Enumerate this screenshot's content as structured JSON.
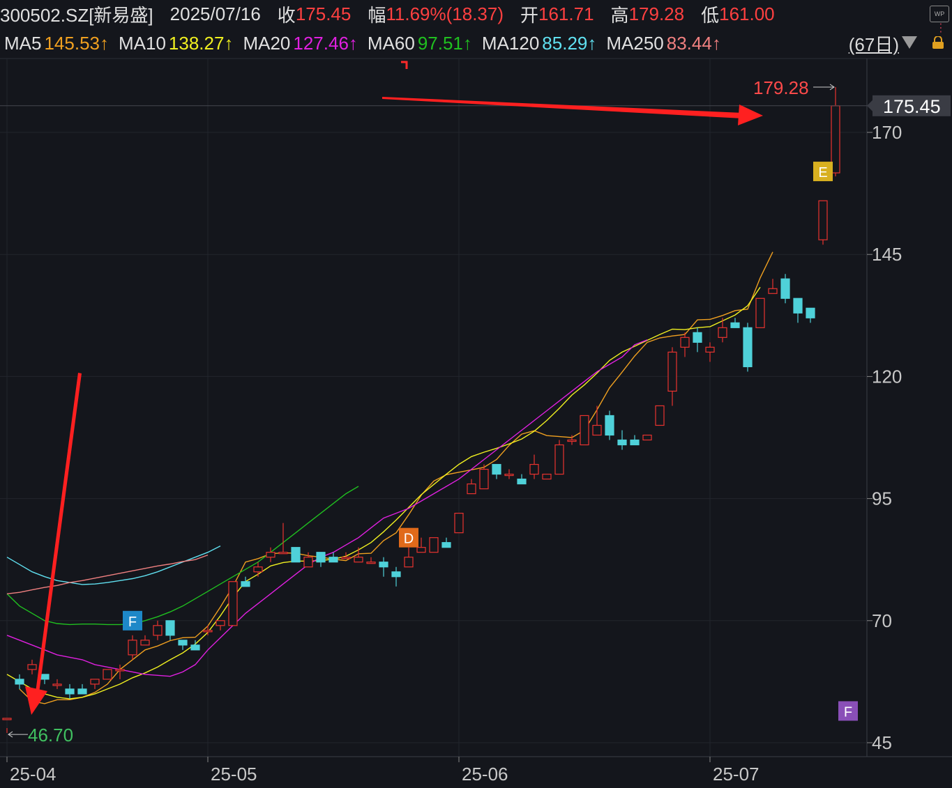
{
  "header": {
    "symbol": "300502.SZ[新易盛]",
    "date": "2025/07/16",
    "close_label": "收",
    "close": "175.45",
    "change_label": "幅",
    "change": "11.69%(18.37)",
    "open_label": "开",
    "open": "161.71",
    "high_label": "高",
    "high": "179.28",
    "low_label": "低",
    "low": "161.00"
  },
  "ma": [
    {
      "name": "MA5",
      "value": "145.53↑",
      "color": "#f0a020"
    },
    {
      "name": "MA10",
      "value": "138.27↑",
      "color": "#f0f020"
    },
    {
      "name": "MA20",
      "value": "127.46↑",
      "color": "#e020e0"
    },
    {
      "name": "MA60",
      "value": "97.51↑",
      "color": "#20c020"
    },
    {
      "name": "MA120",
      "value": "85.29↑",
      "color": "#60e0f0"
    },
    {
      "name": "MA250",
      "value": "83.44↑",
      "color": "#f08080"
    }
  ],
  "period_label": "(67日)",
  "chart_data": {
    "type": "candlestick",
    "y_ticks": [
      45,
      70,
      95,
      120,
      145,
      170
    ],
    "ylim": [
      44,
      180
    ],
    "x_ticks": [
      {
        "label": "25-04",
        "index": 0
      },
      {
        "label": "25-05",
        "index": 16
      },
      {
        "label": "25-06",
        "index": 36
      },
      {
        "label": "25-07",
        "index": 56
      }
    ],
    "last_price": 175.45,
    "max_label": {
      "value": 179.28,
      "text": "179.28"
    },
    "min_label": {
      "value": 46.7,
      "text": "46.70"
    },
    "markers": [
      {
        "text": "F",
        "index": 10,
        "value": 70,
        "color": "#1e88c8"
      },
      {
        "text": "D",
        "index": 32,
        "value": 87,
        "color": "#e06a1a"
      },
      {
        "text": "E",
        "index": 65,
        "value": 162,
        "color": "#d8b020"
      },
      {
        "text": "F",
        "index": 67,
        "value": 51.5,
        "color": "#8a4fb8"
      }
    ],
    "candles": [
      [
        50,
        50,
        48,
        47
      ],
      [
        58,
        57,
        59,
        56
      ],
      [
        60,
        61,
        62,
        59
      ],
      [
        59,
        58,
        59,
        57
      ],
      [
        57,
        57,
        58,
        56
      ],
      [
        56,
        55,
        57,
        54
      ],
      [
        56,
        55,
        57,
        55
      ],
      [
        57,
        58,
        58,
        56
      ],
      [
        58,
        60,
        60,
        58
      ],
      [
        60,
        60,
        61,
        58
      ],
      [
        63,
        66,
        67,
        62
      ],
      [
        65,
        66,
        67,
        65
      ],
      [
        67,
        69,
        70,
        66
      ],
      [
        70,
        67,
        70,
        66
      ],
      [
        66,
        65,
        66,
        64
      ],
      [
        65,
        64,
        66,
        64
      ],
      [
        68,
        68,
        69,
        67
      ],
      [
        69,
        70,
        70,
        68
      ],
      [
        69,
        78,
        78,
        69
      ],
      [
        78,
        77,
        79,
        77
      ],
      [
        80,
        81,
        82,
        79
      ],
      [
        83,
        84,
        85,
        82
      ],
      [
        84,
        84,
        90,
        84
      ],
      [
        85,
        82,
        85,
        82
      ],
      [
        81,
        83,
        84,
        81
      ],
      [
        84,
        82,
        84,
        81
      ],
      [
        83,
        82,
        84,
        83
      ],
      [
        83,
        83,
        84,
        83
      ],
      [
        82,
        83,
        85,
        82
      ],
      [
        82,
        82,
        83,
        82
      ],
      [
        82,
        81,
        83,
        79
      ],
      [
        80,
        79,
        81,
        77
      ],
      [
        81,
        83,
        85,
        81
      ],
      [
        84,
        85,
        87,
        84
      ],
      [
        84,
        87,
        87,
        84
      ],
      [
        86,
        85,
        87,
        85
      ],
      [
        88,
        92,
        92,
        88
      ],
      [
        96,
        98,
        99,
        96
      ],
      [
        97,
        101,
        102,
        97
      ],
      [
        102,
        100,
        102,
        99
      ],
      [
        100,
        100,
        101,
        99
      ],
      [
        99,
        98,
        100,
        98
      ],
      [
        100,
        102,
        104,
        99
      ],
      [
        99,
        100,
        100,
        99
      ],
      [
        100,
        106,
        107,
        100
      ],
      [
        107,
        107,
        108,
        106
      ],
      [
        106,
        112,
        112,
        106
      ],
      [
        108,
        110,
        114,
        108
      ],
      [
        112,
        108,
        113,
        107
      ],
      [
        107,
        106,
        109,
        105
      ],
      [
        107,
        106,
        108,
        106
      ],
      [
        107,
        108,
        108,
        107
      ],
      [
        110,
        114,
        114,
        110
      ],
      [
        117,
        125,
        126,
        114
      ],
      [
        126,
        128,
        129,
        124
      ],
      [
        129,
        127,
        130,
        125
      ],
      [
        125,
        126,
        127,
        123
      ],
      [
        128,
        130,
        132,
        127
      ],
      [
        131,
        130,
        132,
        130
      ],
      [
        130,
        122,
        131,
        121
      ],
      [
        130,
        136,
        136,
        130
      ],
      [
        137,
        138,
        140,
        137
      ],
      [
        140,
        136,
        141,
        135
      ],
      [
        136,
        133,
        136,
        131
      ],
      [
        134,
        132,
        134,
        131
      ],
      [
        148,
        156,
        156,
        147
      ],
      [
        161.71,
        175.45,
        179.28,
        161
      ]
    ],
    "series": [
      {
        "name": "MA5",
        "color": "#f0a020",
        "values": [
          null,
          56,
          53.5,
          53,
          53.8,
          53.8,
          54.3,
          55.3,
          57,
          60,
          62,
          64,
          64.8,
          65.9,
          66.5,
          66.6,
          68.9,
          72.8,
          77,
          82,
          82.7,
          83.7,
          83.9,
          83.8,
          83.3,
          83,
          82.6,
          82.3,
          83.7,
          83.8,
          86.4,
          88,
          91.7,
          95.7,
          98.6,
          99.9,
          100.4,
          100.9,
          101.4,
          103,
          105.9,
          108.2,
          108.9,
          107.9,
          107.7,
          107.5,
          109,
          113.2,
          117.7,
          120.9,
          124.2,
          127,
          127.9,
          128.3,
          128.6,
          131.6,
          131.7,
          132.5,
          133.5,
          133.8,
          140.2,
          145.5
        ]
      },
      {
        "name": "MA10",
        "color": "#f0f020",
        "values": [
          59,
          57.5,
          56,
          55,
          54.3,
          54,
          54.3,
          55,
          56,
          57,
          58.3,
          59.3,
          60.5,
          62,
          63.4,
          65.2,
          67.6,
          71,
          74.8,
          78,
          79.5,
          81.2,
          81.9,
          82.2,
          82.2,
          82.3,
          82.6,
          83.2,
          84.5,
          86,
          88.2,
          90.6,
          93.2,
          95.8,
          97.9,
          100,
          102,
          103.6,
          104.5,
          105.3,
          106.2,
          107.2,
          108.8,
          111,
          113.5,
          116.2,
          118.3,
          120.7,
          123.3,
          125,
          126.2,
          127.4,
          128.6,
          129.7,
          129.6,
          130,
          130.2,
          131.4,
          132.6,
          134.5,
          138.3
        ]
      },
      {
        "name": "MA20",
        "color": "#e020e0",
        "values": [
          67,
          66,
          65,
          64,
          63,
          62.5,
          62,
          61,
          60.5,
          60,
          59.5,
          59,
          58.8,
          58.6,
          59.5,
          61,
          64,
          66.5,
          69,
          71.5,
          73.5,
          75.5,
          77.5,
          79.5,
          81.5,
          83,
          84,
          85.5,
          87,
          89,
          91,
          92,
          93,
          94.5,
          96,
          97.5,
          99,
          101,
          103,
          105,
          107,
          109,
          111,
          113,
          115,
          117,
          119,
          121,
          122.5,
          124,
          126.5,
          127.5
        ]
      },
      {
        "name": "MA60",
        "color": "#20c020",
        "values": [
          75.5,
          73,
          71.5,
          70,
          69.4,
          69.2,
          69.3,
          69.3,
          69.2,
          69.2,
          69.3,
          70,
          70.8,
          71.8,
          73,
          74.5,
          76,
          77.5,
          79,
          80.5,
          82,
          84,
          86,
          88,
          90,
          92,
          94,
          96,
          97.51
        ]
      },
      {
        "name": "MA120",
        "color": "#60e0f0",
        "values": [
          83,
          81.5,
          80,
          79,
          78.2,
          77.8,
          77.4,
          77.5,
          77.8,
          78.2,
          78.6,
          79.2,
          80,
          81,
          82,
          83,
          84,
          85.3
        ]
      },
      {
        "name": "MA250",
        "color": "#f08080",
        "values": [
          75.5,
          75.8,
          76.3,
          76.8,
          77.2,
          77.8,
          78.2,
          78.7,
          79.2,
          79.7,
          80.2,
          80.7,
          81.2,
          81.6,
          82.1,
          82.5,
          83.44
        ]
      }
    ]
  }
}
